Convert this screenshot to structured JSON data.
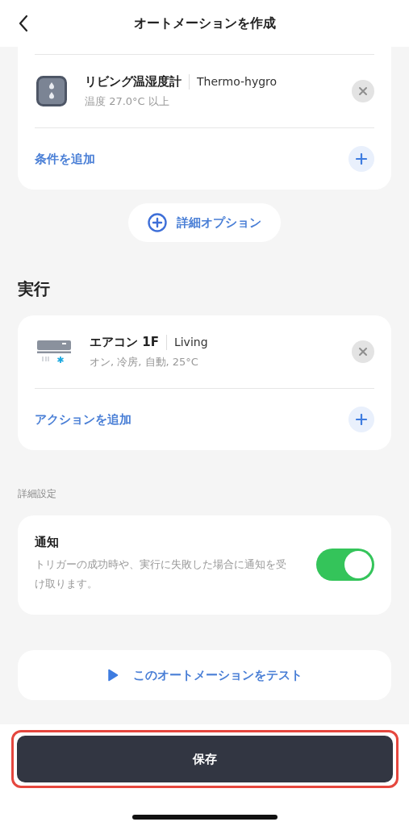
{
  "header": {
    "title": "オートメーションを作成"
  },
  "conditions": {
    "items": [
      {
        "kind": "thermo-hygro",
        "name": "リビング温湿度計",
        "category": "Thermo-hygro",
        "detail": "温度 27.0°C 以上"
      }
    ],
    "add_label": "条件を追加"
  },
  "options_button": {
    "label": "詳細オプション"
  },
  "actions": {
    "title": "実行",
    "items": [
      {
        "kind": "air-conditioner",
        "name": "エアコン 1F",
        "category": "Living",
        "detail": "オン, 冷房, 自動, 25°C"
      }
    ],
    "add_label": "アクションを追加"
  },
  "advanced": {
    "title": "詳細設定",
    "notification": {
      "title": "通知",
      "description": "トリガーの成功時や、実行に失敗した場合に通知を受け取ります。",
      "on": true
    }
  },
  "test_button": {
    "label": "このオートメーションをテスト"
  },
  "save_button": {
    "label": "保存",
    "highlighted": true
  }
}
